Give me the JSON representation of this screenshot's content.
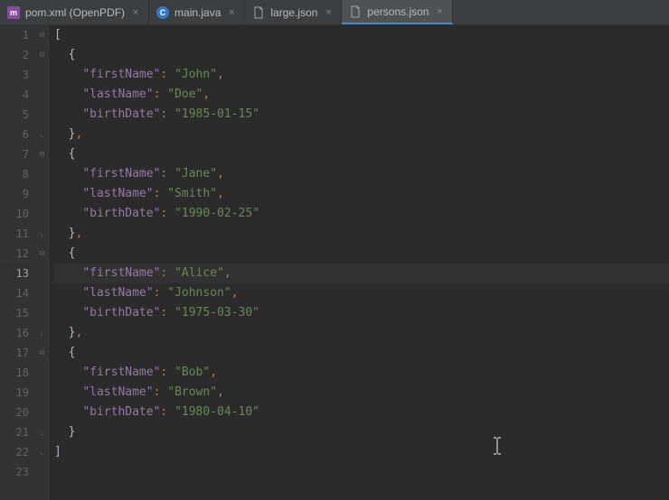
{
  "tabs": [
    {
      "label": "pom.xml (OpenPDF)",
      "icon": "m",
      "active": false
    },
    {
      "label": "main.java",
      "icon": "c",
      "active": false
    },
    {
      "label": "large.json",
      "icon": "json",
      "active": false
    },
    {
      "label": "persons.json",
      "icon": "json",
      "active": true
    }
  ],
  "lines": [
    {
      "num": "1",
      "tokens": [
        {
          "cls": "p-bracket",
          "t": "["
        }
      ],
      "indent": 0,
      "fold": "open"
    },
    {
      "num": "2",
      "tokens": [
        {
          "cls": "p-brace",
          "t": "{"
        }
      ],
      "indent": 1,
      "fold": "open"
    },
    {
      "num": "3",
      "tokens": [
        {
          "cls": "p-key",
          "t": "\"firstName\""
        },
        {
          "cls": "p-punct",
          "t": ": "
        },
        {
          "cls": "p-string",
          "t": "\"John\""
        },
        {
          "cls": "p-comma",
          "t": ","
        }
      ],
      "indent": 2
    },
    {
      "num": "4",
      "tokens": [
        {
          "cls": "p-key",
          "t": "\"lastName\""
        },
        {
          "cls": "p-punct",
          "t": ": "
        },
        {
          "cls": "p-string",
          "t": "\"Doe\""
        },
        {
          "cls": "p-comma",
          "t": ","
        }
      ],
      "indent": 2
    },
    {
      "num": "5",
      "tokens": [
        {
          "cls": "p-key",
          "t": "\"birthDate\""
        },
        {
          "cls": "p-punct",
          "t": ": "
        },
        {
          "cls": "p-string",
          "t": "\"1985-01-15\""
        }
      ],
      "indent": 2
    },
    {
      "num": "6",
      "tokens": [
        {
          "cls": "p-brace",
          "t": "}"
        },
        {
          "cls": "p-comma",
          "t": ","
        }
      ],
      "indent": 1,
      "fold": "close"
    },
    {
      "num": "7",
      "tokens": [
        {
          "cls": "p-brace",
          "t": "{"
        }
      ],
      "indent": 1,
      "fold": "open"
    },
    {
      "num": "8",
      "tokens": [
        {
          "cls": "p-key",
          "t": "\"firstName\""
        },
        {
          "cls": "p-punct",
          "t": ": "
        },
        {
          "cls": "p-string",
          "t": "\"Jane\""
        },
        {
          "cls": "p-comma",
          "t": ","
        }
      ],
      "indent": 2
    },
    {
      "num": "9",
      "tokens": [
        {
          "cls": "p-key",
          "t": "\"lastName\""
        },
        {
          "cls": "p-punct",
          "t": ": "
        },
        {
          "cls": "p-string",
          "t": "\"Smith\""
        },
        {
          "cls": "p-comma",
          "t": ","
        }
      ],
      "indent": 2
    },
    {
      "num": "10",
      "tokens": [
        {
          "cls": "p-key",
          "t": "\"birthDate\""
        },
        {
          "cls": "p-punct",
          "t": ": "
        },
        {
          "cls": "p-string",
          "t": "\"1990-02-25\""
        }
      ],
      "indent": 2
    },
    {
      "num": "11",
      "tokens": [
        {
          "cls": "p-brace",
          "t": "}"
        },
        {
          "cls": "p-comma",
          "t": ","
        }
      ],
      "indent": 1,
      "fold": "close"
    },
    {
      "num": "12",
      "tokens": [
        {
          "cls": "p-brace",
          "t": "{"
        }
      ],
      "indent": 1,
      "fold": "open"
    },
    {
      "num": "13",
      "tokens": [
        {
          "cls": "p-key",
          "t": "\"firstName\""
        },
        {
          "cls": "p-punct",
          "t": ": "
        },
        {
          "cls": "p-string",
          "t": "\"Alice\""
        },
        {
          "cls": "p-comma",
          "t": ","
        }
      ],
      "indent": 2,
      "current": true
    },
    {
      "num": "14",
      "tokens": [
        {
          "cls": "p-key",
          "t": "\"lastName\""
        },
        {
          "cls": "p-punct",
          "t": ": "
        },
        {
          "cls": "p-string",
          "t": "\"Johnson\""
        },
        {
          "cls": "p-comma",
          "t": ","
        }
      ],
      "indent": 2
    },
    {
      "num": "15",
      "tokens": [
        {
          "cls": "p-key",
          "t": "\"birthDate\""
        },
        {
          "cls": "p-punct",
          "t": ": "
        },
        {
          "cls": "p-string",
          "t": "\"1975-03-30\""
        }
      ],
      "indent": 2
    },
    {
      "num": "16",
      "tokens": [
        {
          "cls": "p-brace",
          "t": "}"
        },
        {
          "cls": "p-comma",
          "t": ","
        }
      ],
      "indent": 1,
      "fold": "close"
    },
    {
      "num": "17",
      "tokens": [
        {
          "cls": "p-brace",
          "t": "{"
        }
      ],
      "indent": 1,
      "fold": "open"
    },
    {
      "num": "18",
      "tokens": [
        {
          "cls": "p-key",
          "t": "\"firstName\""
        },
        {
          "cls": "p-punct",
          "t": ": "
        },
        {
          "cls": "p-string",
          "t": "\"Bob\""
        },
        {
          "cls": "p-comma",
          "t": ","
        }
      ],
      "indent": 2
    },
    {
      "num": "19",
      "tokens": [
        {
          "cls": "p-key",
          "t": "\"lastName\""
        },
        {
          "cls": "p-punct",
          "t": ": "
        },
        {
          "cls": "p-string",
          "t": "\"Brown\""
        },
        {
          "cls": "p-comma",
          "t": ","
        }
      ],
      "indent": 2
    },
    {
      "num": "20",
      "tokens": [
        {
          "cls": "p-key",
          "t": "\"birthDate\""
        },
        {
          "cls": "p-punct",
          "t": ": "
        },
        {
          "cls": "p-string",
          "t": "\"1980-04-10\""
        }
      ],
      "indent": 2
    },
    {
      "num": "21",
      "tokens": [
        {
          "cls": "p-brace",
          "t": "}"
        }
      ],
      "indent": 1,
      "fold": "close"
    },
    {
      "num": "22",
      "tokens": [
        {
          "cls": "p-bracket",
          "t": "]"
        }
      ],
      "indent": 0,
      "fold": "close"
    },
    {
      "num": "23",
      "tokens": [],
      "indent": 0
    }
  ]
}
